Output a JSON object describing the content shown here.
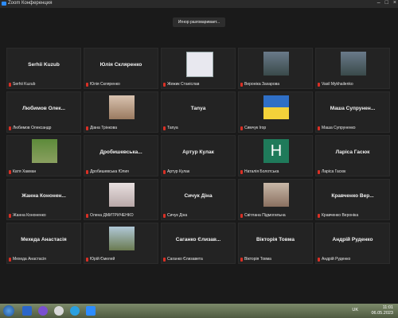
{
  "window": {
    "title": "Zoom Конференция"
  },
  "speaking": "Игнор разговаривает...",
  "tiles": [
    {
      "big": "Serhii Kuzub",
      "caption": "Serhii Kuzub",
      "avatar": ""
    },
    {
      "big": "Юлія Скляренко",
      "caption": "Юлія Скляренко",
      "avatar": ""
    },
    {
      "big": "",
      "caption": "Жежик Станіслав",
      "avatar": "logo"
    },
    {
      "big": "",
      "caption": "Вероніка Захарова",
      "avatar": "person"
    },
    {
      "big": "",
      "caption": "Vasil Mykhailenko",
      "avatar": "person"
    },
    {
      "big": "Любимов Олек...",
      "caption": "Любимов Олександр",
      "avatar": ""
    },
    {
      "big": "",
      "caption": "Діана Трінкова",
      "avatar": "doll"
    },
    {
      "big": "Таnya",
      "caption": "Таnya",
      "avatar": ""
    },
    {
      "big": "",
      "caption": "Симчук Ігор",
      "avatar": "flag"
    },
    {
      "big": "Маша Супрунен...",
      "caption": "Маша Супруненко",
      "avatar": ""
    },
    {
      "big": "",
      "caption": "Катя Хакман",
      "avatar": "green"
    },
    {
      "big": "Дробишевська...",
      "caption": "Дробишевська Юлия",
      "avatar": ""
    },
    {
      "big": "Артур Кулак",
      "caption": "Артур Кулак",
      "avatar": ""
    },
    {
      "big": "",
      "caption": "Наталія Болотська",
      "avatar": "H"
    },
    {
      "big": "Ларіса Гасюк",
      "caption": "Ларіса Гасюк",
      "avatar": ""
    },
    {
      "big": "Жанна Кононен...",
      "caption": "Жанна Кононенко",
      "avatar": ""
    },
    {
      "big": "",
      "caption": "Олена ДМИТРИЧЕНКО",
      "avatar": "gray"
    },
    {
      "big": "Сичук Діна",
      "caption": "Сичук Діна",
      "avatar": ""
    },
    {
      "big": "",
      "caption": "Світлана Підмогильна",
      "avatar": "room"
    },
    {
      "big": "Кравченко Вер...",
      "caption": "Кравченко Вероніка",
      "avatar": ""
    },
    {
      "big": "Мехеда Анастасія",
      "caption": "Мехеда Анастасія",
      "avatar": ""
    },
    {
      "big": "",
      "caption": "Юрій Ємелей",
      "avatar": "outdoor"
    },
    {
      "big": "Саганко Єлизав...",
      "caption": "Саганко Єлизавета",
      "avatar": ""
    },
    {
      "big": "Вікторія Товма",
      "caption": "Вікторія Товма",
      "avatar": ""
    },
    {
      "big": "Андрій Руденко",
      "caption": "Андрій Руденко",
      "avatar": ""
    }
  ],
  "taskbar": {
    "lang": "UK",
    "time": "11:01",
    "date": "06.05.2023"
  }
}
